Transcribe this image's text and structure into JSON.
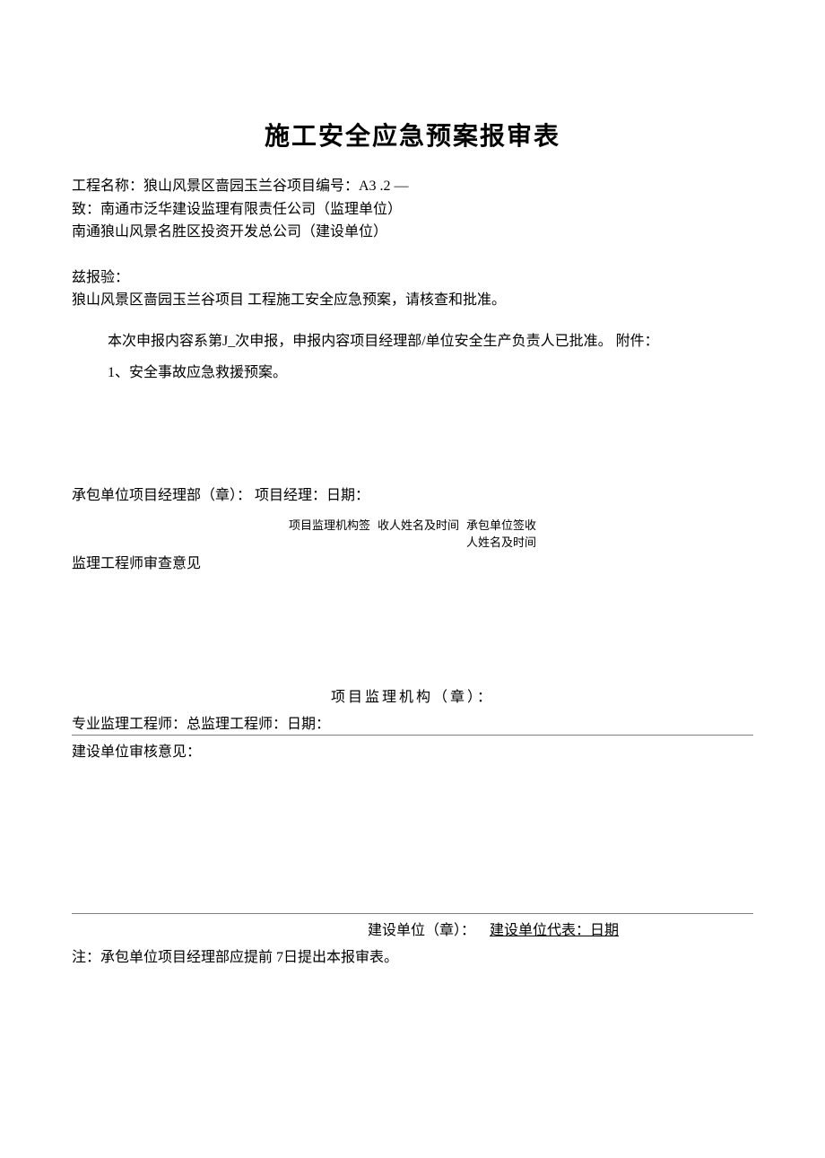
{
  "title": "施工安全应急预案报审表",
  "header": {
    "project_name": "工程名称：狼山风景区啬园玉兰谷项目编号：A3 .2 —",
    "to": "致：南通市泛华建设监理有限责任公司（监理单位）",
    "investor": "南通狼山风景名胜区投资开发总公司（建设单位）"
  },
  "report": {
    "submit_label": "兹报验：",
    "content": "狼山风景区啬园玉兰谷项目  工程施工安全应急预案，请核查和批准。"
  },
  "indent": {
    "line1": "本次申报内容系第J_次申报，申报内容项目经理部/单位安全生产负责人已批准。  附件：",
    "line2": "1、安全事故应急救援预案。"
  },
  "contractor": "承包单位项目经理部（章）：  项目经理：日期：",
  "sign": {
    "col1": "项目监理机构签",
    "col2": "收人姓名及时间",
    "col3a": "承包单位签收",
    "col3b": "人姓名及时间"
  },
  "supervisor_opinion": "监理工程师审查意见",
  "org_stamp": "项目监理机构（章）：",
  "engineer_line": "专业监理工程师：总监理工程师：日期：",
  "construction_opinion": "建设单位审核意见：",
  "construction_stamp": {
    "part1": "建设单位（章）：",
    "part2": "建设单位代表：日期"
  },
  "note": "注：承包单位项目经理部应提前  7日提出本报审表。"
}
